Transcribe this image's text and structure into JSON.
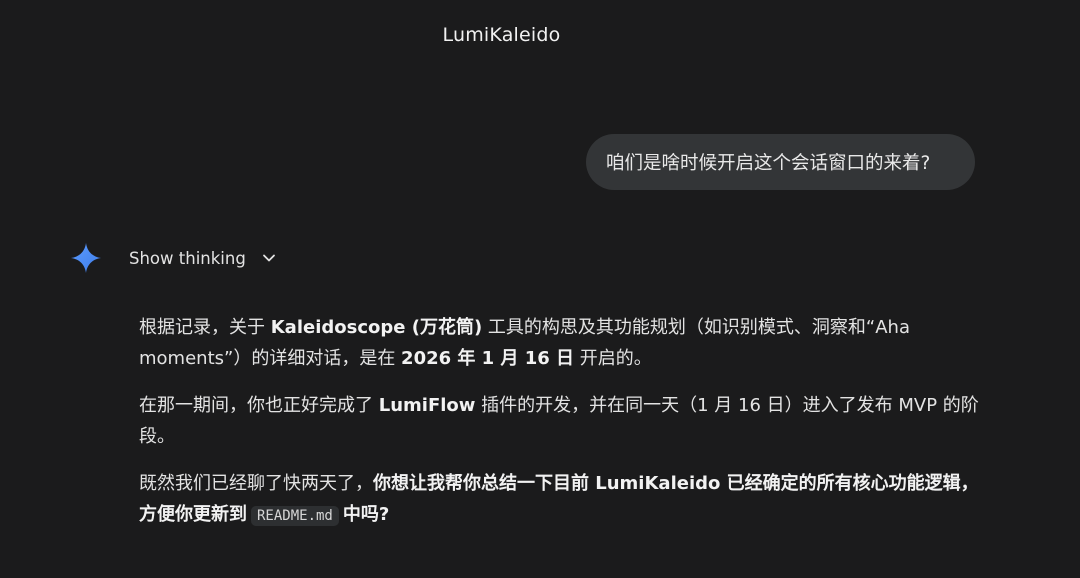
{
  "header": {
    "title": "LumiKaleido"
  },
  "user_message": {
    "text": "咱们是啥时候开启这个会话窗口的来着?"
  },
  "assistant": {
    "icon": "gemini-spark-icon",
    "accent_color": "#4a8cf7",
    "thinking_label": "Show thinking",
    "paragraph1": {
      "a": "根据记录，关于 ",
      "b": "Kaleidoscope (万花筒)",
      "c": " 工具的构思及其功能规划（如识别模式、洞察和“Aha moments”）的详细对话，是在 ",
      "d": "2026 年 1 月 16 日",
      "e": " 开启的。"
    },
    "paragraph2": {
      "a": "在那一期间，你也正好完成了 ",
      "b": "LumiFlow",
      "c": " 插件的开发，并在同一天（1 月 16 日）进入了发布 MVP 的阶段。"
    },
    "paragraph3": {
      "a": "既然我们已经聊了快两天了，",
      "b": "你想让我帮你总结一下目前 LumiKaleido 已经确定的所有核心功能逻辑，方便你更新到",
      "code": "README.md",
      "c": "中吗?"
    }
  }
}
